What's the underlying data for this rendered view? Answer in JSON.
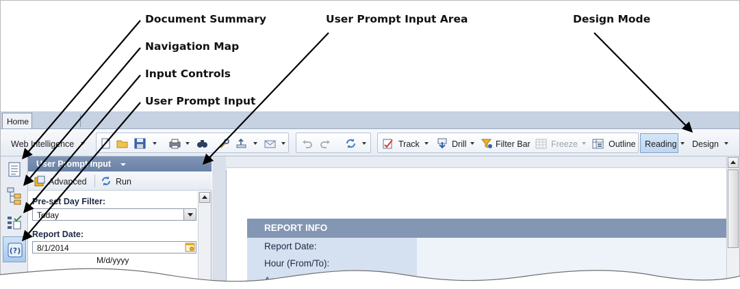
{
  "callouts": {
    "document_summary": "Document Summary",
    "navigation_map": "Navigation Map",
    "input_controls": "Input Controls",
    "user_prompt_input": "User Prompt Input",
    "user_prompt_input_area": "User Prompt Input Area",
    "design_mode": "Design Mode"
  },
  "tabs": {
    "home": "Home"
  },
  "toolbar": {
    "app_menu": "Web Intelligence",
    "track": "Track",
    "drill": "Drill",
    "filter_bar": "Filter Bar",
    "freeze": "Freeze",
    "outline": "Outline",
    "reading": "Reading",
    "design": "Design"
  },
  "left_rail": {
    "items": [
      {
        "icon": "document-summary-icon"
      },
      {
        "icon": "navigation-map-icon"
      },
      {
        "icon": "input-controls-icon"
      },
      {
        "icon": "user-prompt-icon",
        "label": "(?)"
      }
    ]
  },
  "panel": {
    "title": "User Prompt Input",
    "advanced": "Advanced",
    "run": "Run",
    "preset_label": "Pre-set Day Filter:",
    "preset_value": "Today",
    "report_date_label": "Report Date:",
    "report_date_value": "8/1/2014",
    "date_format": "M/d/yyyy"
  },
  "report": {
    "header": "REPORT INFO",
    "rows": [
      "Report Date:",
      "Hour (From/To):",
      "Agent Group:"
    ]
  },
  "colors": {
    "panel_header": "#7389ab",
    "report_header": "#8396b3",
    "report_label_bg": "#d5e1f0",
    "active_button": "#bfd6f0"
  }
}
